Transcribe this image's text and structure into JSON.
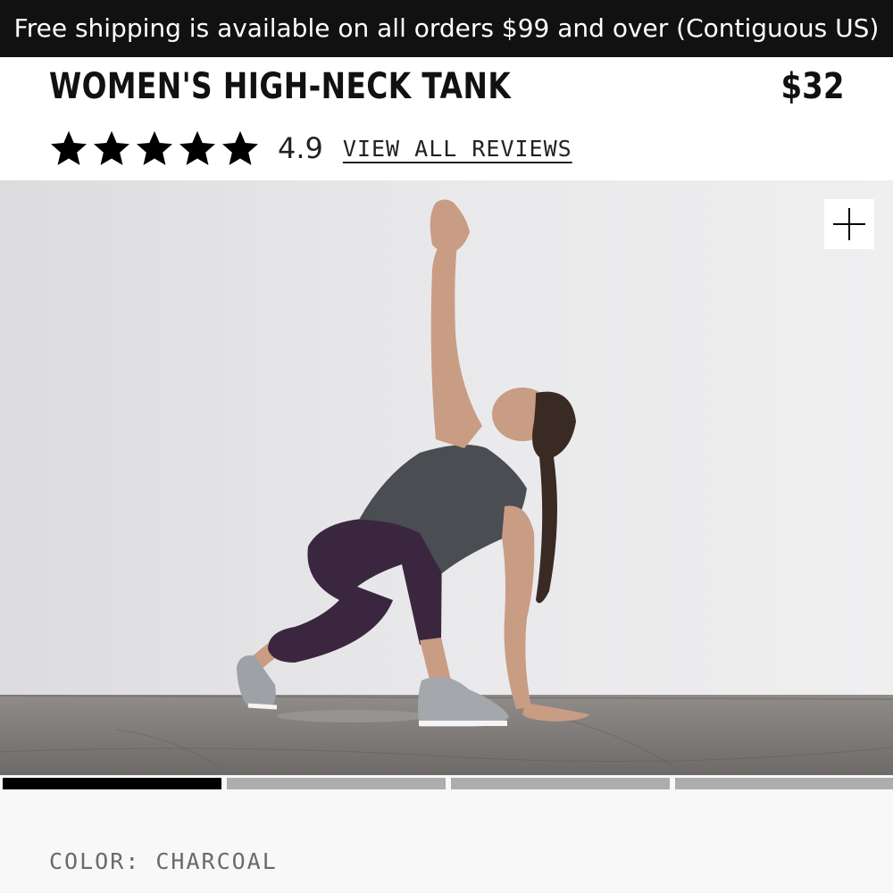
{
  "banner": {
    "text": "Free shipping is available on all orders $99 and over (Contiguous US)"
  },
  "product": {
    "title": "WOMEN'S HIGH-NECK TANK",
    "price": "$32",
    "rating": {
      "value": "4.9",
      "stars": 5,
      "reviews_link": "VIEW ALL REVIEWS"
    }
  },
  "gallery": {
    "zoom_icon": "plus-icon",
    "image_description": "product photo",
    "slides": 4,
    "active_slide": 1
  },
  "options": {
    "color_label": "COLOR:",
    "color_value": "CHARCOAL"
  },
  "colors": {
    "banner_bg": "#111111",
    "accent": "#000000",
    "inactive_dot": "#adadad"
  }
}
